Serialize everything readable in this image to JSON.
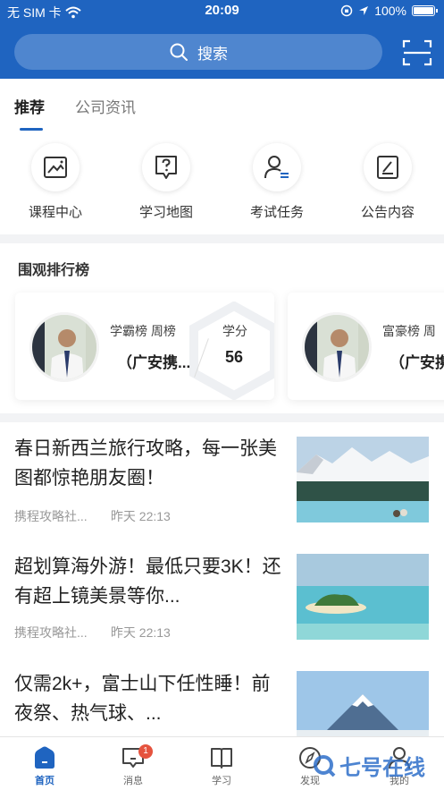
{
  "status_bar": {
    "carrier": "无 SIM 卡",
    "time": "20:09",
    "battery": "100%"
  },
  "search": {
    "placeholder": "搜索"
  },
  "tabs": [
    {
      "label": "推荐"
    },
    {
      "label": "公司资讯"
    }
  ],
  "quick_entries": [
    {
      "label": "课程中心",
      "icon": "image-icon"
    },
    {
      "label": "学习地图",
      "icon": "help-map-icon"
    },
    {
      "label": "考试任务",
      "icon": "user-list-icon"
    },
    {
      "label": "公告内容",
      "icon": "edit-icon"
    }
  ],
  "ranking": {
    "title": "围观排行榜",
    "cards": [
      {
        "category": "学霸榜 周榜",
        "name": "（广安携...",
        "score_label": "学分",
        "score": "56"
      },
      {
        "category": "富豪榜 周",
        "name": "（广安携"
      }
    ]
  },
  "articles": [
    {
      "title": "春日新西兰旅行攻略，每一张美图都惊艳朋友圈！",
      "source": "携程攻略社...",
      "time": "昨天 22:13"
    },
    {
      "title": "超划算海外游！最低只要3K！还有超上镜美景等你...",
      "source": "携程攻略社...",
      "time": "昨天 22:13"
    },
    {
      "title": "仅需2k+，富士山下任性睡！前夜祭、热气球、..."
    }
  ],
  "bottom_nav": [
    {
      "label": "首页",
      "active": true
    },
    {
      "label": "消息",
      "badge": "1"
    },
    {
      "label": "学习"
    },
    {
      "label": "发现"
    },
    {
      "label": "我的"
    }
  ],
  "watermark": "七号在线",
  "colors": {
    "primary": "#1f64c0",
    "badge": "#e5533e"
  }
}
